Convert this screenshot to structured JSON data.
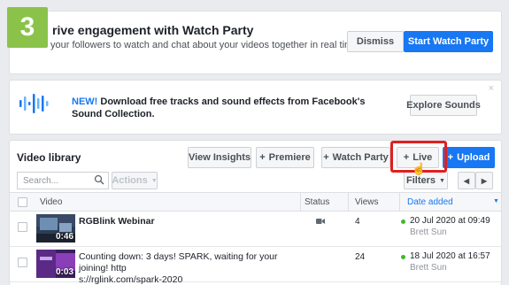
{
  "step_badge": "3",
  "watch_party": {
    "title": "rive engagement with Watch Party",
    "subtitle": "your followers to watch and chat about your videos together in real time.",
    "dismiss_label": "Dismiss",
    "start_label": "Start Watch Party"
  },
  "sound_promo": {
    "new_label": "NEW!",
    "text": "Download free tracks and sound effects from Facebook's Sound Collection.",
    "explore_label": "Explore Sounds",
    "close_glyph": "×"
  },
  "library": {
    "title": "Video library",
    "buttons": {
      "insights": "View Insights",
      "premiere": "Premiere",
      "watch_party": "Watch Party",
      "live": "Live",
      "upload": "Upload"
    },
    "search_placeholder": "Search...",
    "actions_label": "Actions",
    "filters_label": "Filters",
    "columns": {
      "video": "Video",
      "status": "Status",
      "views": "Views",
      "date": "Date added"
    },
    "rows": [
      {
        "title": "RGBlink Webinar",
        "duration": "0:46",
        "views": "4",
        "date": "20 Jul 2020 at 09:49",
        "author": "Brett Sun"
      },
      {
        "title": "Counting down: 3 days! SPARK, waiting for your joining! https://rglink.com/spark-2020",
        "title_line1": "Counting down: 3 days! SPARK, waiting for your joining! http",
        "title_line2": "s://rglink.com/spark-2020",
        "duration": "0:03",
        "views": "24",
        "date": "18 Jul 2020 at 16:57",
        "author": "Brett Sun"
      }
    ]
  },
  "colors": {
    "accent": "#1877f2",
    "badge": "#8bc34a",
    "highlight": "#e02020",
    "status_dot": "#42b72a"
  }
}
